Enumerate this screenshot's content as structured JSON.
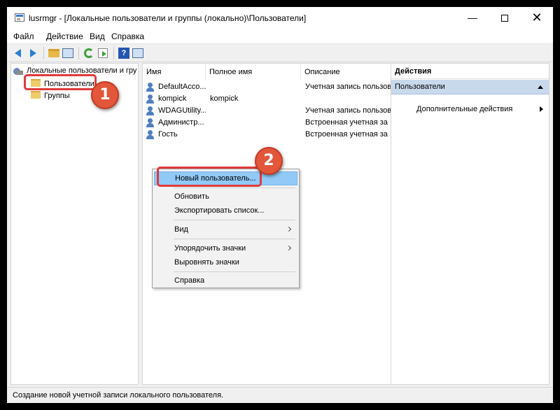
{
  "window": {
    "title": "lusrmgr - [Локальные пользователи и группы (локально)\\Пользователи]",
    "minimize": "—",
    "close": "✕"
  },
  "menu": [
    "Файл",
    "Действие",
    "Вид",
    "Справка"
  ],
  "toolbar": {
    "buttons": [
      "back-icon",
      "forward-icon",
      "up-folder-icon",
      "show-hide-tree-icon",
      "refresh-icon",
      "export-list-icon",
      "help-icon",
      "show-hide-actions-icon"
    ],
    "help_glyph": "?"
  },
  "tree": {
    "root": "Локальные пользователи и гру",
    "items": [
      "Пользователи",
      "Группы"
    ]
  },
  "list": {
    "columns": [
      "Имя",
      "Полное имя",
      "Описание"
    ],
    "rows": [
      {
        "name": "DefaultAcco...",
        "full_name": "",
        "description": "Учетная запись пользов"
      },
      {
        "name": "kompick",
        "full_name": "kompick",
        "description": ""
      },
      {
        "name": "WDAGUtility...",
        "full_name": "",
        "description": "Учетная запись пользов"
      },
      {
        "name": "Администр...",
        "full_name": "",
        "description": "Встроенная учетная за"
      },
      {
        "name": "Гость",
        "full_name": "",
        "description": "Встроенная учетная за"
      }
    ]
  },
  "actions": {
    "title": "Действия",
    "section": "Пользователи",
    "more": "Дополнительные действия"
  },
  "context_menu": {
    "items": [
      "Новый пользователь...",
      "Обновить",
      "Экспортировать список...",
      "Вид",
      "Упорядочить значки",
      "Выровнять значки",
      "Справка"
    ]
  },
  "status": "Создание новой учетной записи локального пользователя.",
  "annotations": {
    "badge1": "1",
    "badge2": "2"
  },
  "colors": {
    "highlight": "#91c9f7",
    "callout": "#e03b3b",
    "badge": "#e2563a",
    "actions_section": "#c9d9ec"
  }
}
